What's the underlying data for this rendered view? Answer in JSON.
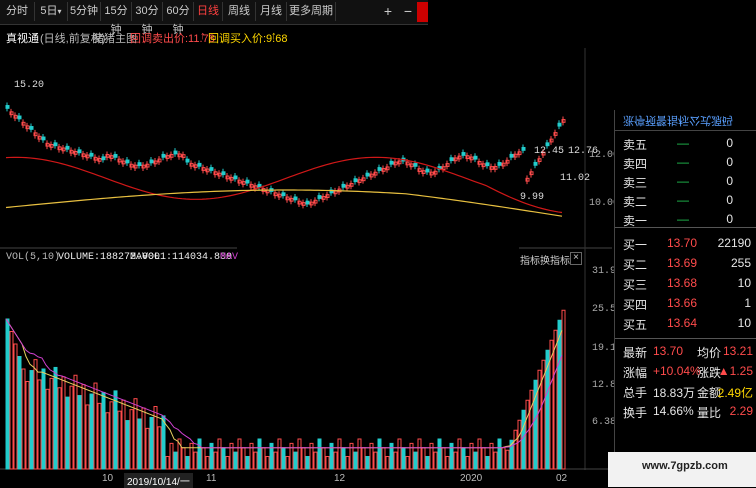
{
  "toolbar": {
    "items": [
      "分时",
      "5日",
      "5分钟",
      "15分钟",
      "30分钟",
      "60分钟",
      "日线",
      "周线",
      "月线",
      "更多周期"
    ],
    "dropdown_caret": "▾",
    "plus": "+",
    "minus": "−"
  },
  "price_header": {
    "chart_name": "真视通",
    "adjust": "(日线,前复权)",
    "indicator": "猪猪主图",
    "sell_label": "回调卖出价:11.78",
    "sell_arrow": "↑",
    "buy_label": "回调买入价:9.68",
    "buy_arrow": "↑"
  },
  "price_axis": [
    "12.00",
    "10.00"
  ],
  "price_annotations": {
    "high": "15.20",
    "mid_left": "12.45",
    "mid_right": "12.76",
    "low_right": "11.02",
    "low": "9.99"
  },
  "vol_header": {
    "name": "VOL(5,10)",
    "volume": "VOLUME:188272.000",
    "mavol1": "MAVOL1:114034.800",
    "mavol2": "MAV",
    "btn1": "指标",
    "btn2": "换指标",
    "close": "×"
  },
  "vol_axis": [
    "31.90",
    "25.52",
    "19.10",
    "12.80",
    "6.38"
  ],
  "date_axis": [
    "10",
    "2019/10/14/一",
    "11",
    "12",
    "2020",
    "02"
  ],
  "quote_panel": {
    "title": "涨停预警指标公式源码",
    "sells": [
      {
        "label": "卖五",
        "price": "—",
        "vol": "0"
      },
      {
        "label": "卖四",
        "price": "—",
        "vol": "0"
      },
      {
        "label": "卖三",
        "price": "—",
        "vol": "0"
      },
      {
        "label": "卖二",
        "price": "—",
        "vol": "0"
      },
      {
        "label": "卖一",
        "price": "—",
        "vol": "0"
      }
    ],
    "buys": [
      {
        "label": "买一",
        "price": "13.70",
        "vol": "22190"
      },
      {
        "label": "买二",
        "price": "13.69",
        "vol": "255"
      },
      {
        "label": "买三",
        "price": "13.68",
        "vol": "10"
      },
      {
        "label": "买四",
        "price": "13.66",
        "vol": "1"
      },
      {
        "label": "买五",
        "price": "13.64",
        "vol": "10"
      }
    ],
    "stats": [
      {
        "l1": "最新",
        "v1": "13.70",
        "l2": "均价",
        "v2": "13.21"
      },
      {
        "l1": "涨幅",
        "v1": "+10.04%",
        "l2": "涨跌",
        "v2": "▲1.25"
      },
      {
        "l1": "总手",
        "v1": "18.83万",
        "l2": "金额",
        "v2": "2.49亿"
      },
      {
        "l1": "换手",
        "v1": "14.66%",
        "l2": "量比",
        "v2": "2.29"
      }
    ]
  },
  "watermark": {
    "site": "www.7gpzb.com"
  },
  "colors": {
    "up": "#ff4b4b",
    "down": "#22cccc",
    "ma_red": "#d01818",
    "ma_yellow": "#e8c040",
    "vol_ma1": "#ffffff",
    "vol_ma2": "#d040d0"
  }
}
